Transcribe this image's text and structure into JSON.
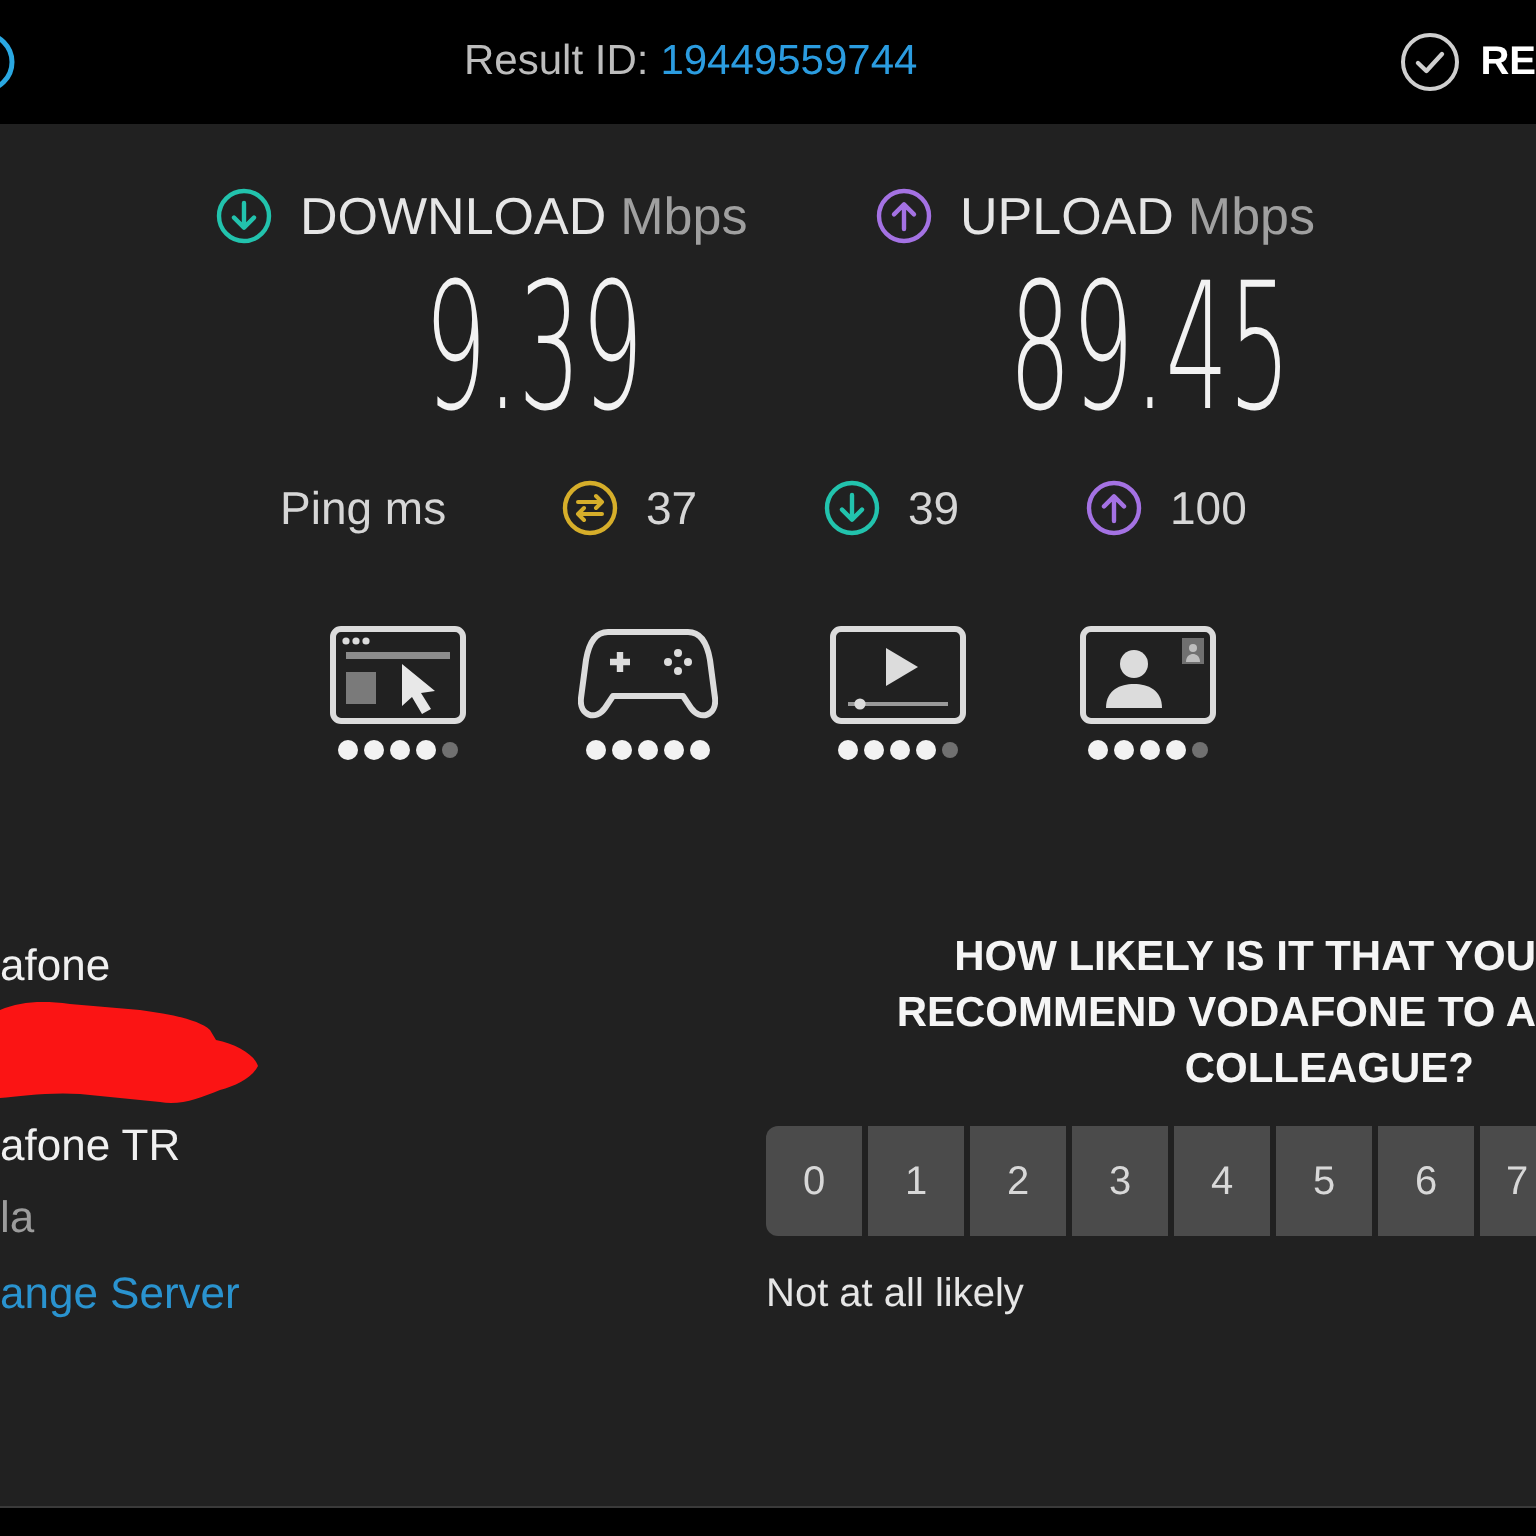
{
  "top_bar": {
    "result_label": "Result ID:",
    "result_id": "19449559744",
    "right_text": "RE"
  },
  "speeds": [
    {
      "kind": "download",
      "label": "DOWNLOAD",
      "unit": "Mbps",
      "value": "9.39"
    },
    {
      "kind": "upload",
      "label": "UPLOAD",
      "unit": "Mbps",
      "value": "89.45"
    }
  ],
  "ping": {
    "label": "Ping ms",
    "readings": [
      {
        "kind": "idle",
        "value": "37"
      },
      {
        "kind": "download",
        "value": "39"
      },
      {
        "kind": "upload",
        "value": "100"
      }
    ]
  },
  "activities": [
    {
      "kind": "browsing",
      "stars": 4
    },
    {
      "kind": "gaming",
      "stars": 5
    },
    {
      "kind": "streaming",
      "stars": 4
    },
    {
      "kind": "video_call",
      "stars": 4
    }
  ],
  "connection": {
    "lines": [
      {
        "kind": "text",
        "text": "afone"
      },
      {
        "kind": "redacted"
      },
      {
        "kind": "text",
        "text": "afone TR"
      },
      {
        "kind": "muted",
        "text": "la"
      },
      {
        "kind": "link",
        "text": "ange Server"
      }
    ]
  },
  "survey": {
    "question_lines": [
      "HOW LIKELY IS IT THAT YOU",
      "RECOMMEND VODAFONE TO A",
      "COLLEAGUE?"
    ],
    "scale": [
      "0",
      "1",
      "2",
      "3",
      "4",
      "5",
      "6",
      "7"
    ],
    "low_label": "Not at all likely"
  }
}
